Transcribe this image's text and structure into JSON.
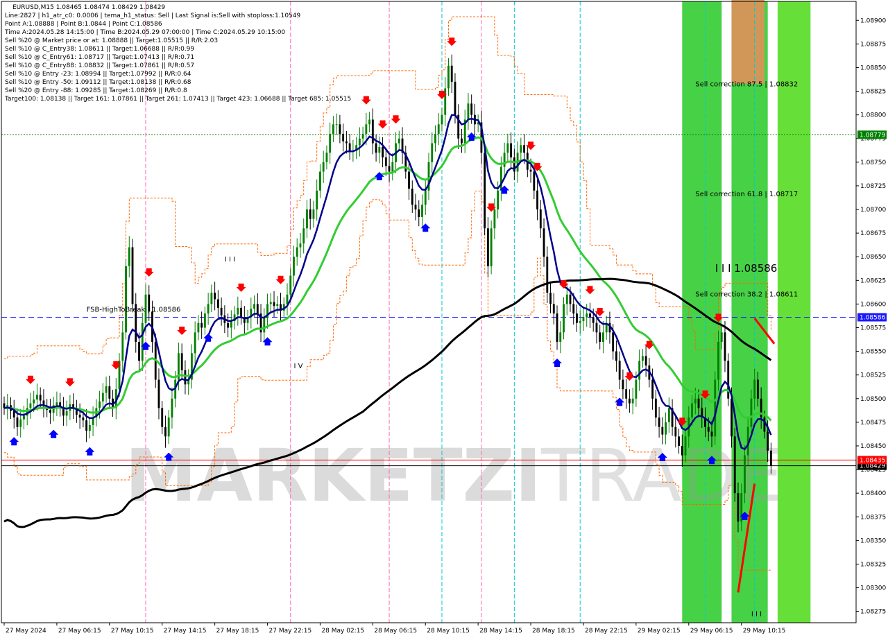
{
  "chart_data": {
    "type": "candlestick",
    "symbol": "EURUSD",
    "timeframe": "M15",
    "header": "EURUSD,M15  1.08465 1.08474 1.08429 1.08429",
    "info_lines": [
      "Line:2827 | h1_atr_c0: 0.0006 | tema_h1_status: Sell | Last Signal is:Sell with stoploss:1.10549",
      "Point A:1.08888 | Point B:1.0844 | Point C:1.08586",
      "Time A:2024.05.28 14:15:00 | Time B:2024.05.29 07:00:00 | Time C:2024.05.29 10:15:00",
      "Sell %20 @ Market price or at: 1.08888 || Target:1.05515 || R/R:2.03",
      "Sell %10 @ C_Entry38: 1.08611 || Target:1.06688 || R/R:0.99",
      "Sell %10 @ C_Entry61: 1.08717 || Target:1.07413 || R/R:0.71",
      "Sell %10 @ C_Entry88: 1.08832 || Target:1.07861 || R/R:0.57",
      "Sell %10 @ Entry -23: 1.08994 || Target:1.07992 || R/R:0.64",
      "Sell %10 @ Entry -50: 1.09112 || Target:1.08138 || R/R:0.68",
      "Sell %20 @ Entry -88: 1.09285 || Target:1.08269 || R/R:0.8",
      "Target100: 1.08138 || Target 161: 1.07861 || Target 261: 1.07413 || Target 423: 1.06688 || Target 685: 1.05515"
    ],
    "y_range": [
      1.0827,
      1.0893
    ],
    "y_ticks": [
      1.0898,
      1.0895,
      1.0885,
      1.0885,
      1.088,
      1.0878,
      1.0875,
      1.0873,
      1.087,
      1.0868,
      1.0865,
      1.0863,
      1.086,
      1.0858,
      1.0855,
      1.0853,
      1.085,
      1.0848,
      1.0845,
      1.0843,
      1.084,
      1.0838,
      1.0835,
      1.0833,
      1.083,
      1.0828
    ],
    "y_tick_labels": [
      "1.08900",
      "1.08875",
      "1.08850",
      "1.08825",
      "1.08800",
      "1.08775",
      "1.08750",
      "1.08725",
      "1.08700",
      "1.08675",
      "1.08650",
      "1.08625",
      "1.08600",
      "1.08575",
      "1.08550",
      "1.08525",
      "1.08500",
      "1.08475",
      "1.08450",
      "1.08425",
      "1.08400",
      "1.08375",
      "1.08350",
      "1.08325",
      "1.08300",
      "1.08275"
    ],
    "y_tick_values": [
      1.089,
      1.08875,
      1.0885,
      1.08825,
      1.088,
      1.08775,
      1.0875,
      1.08725,
      1.087,
      1.08675,
      1.0865,
      1.08625,
      1.086,
      1.08575,
      1.0855,
      1.08525,
      1.085,
      1.08475,
      1.0845,
      1.08425,
      1.084,
      1.08375,
      1.0835,
      1.08325,
      1.083,
      1.08275
    ],
    "x_labels": [
      "27 May 2024",
      "27 May 06:15",
      "27 May 10:15",
      "27 May 14:15",
      "27 May 18:15",
      "27 May 22:15",
      "28 May 02:15",
      "28 May 06:15",
      "28 May 10:15",
      "28 May 14:15",
      "28 May 18:15",
      "28 May 22:15",
      "29 May 02:15",
      "29 May 06:15",
      "29 May 10:15"
    ],
    "x_label_index": [
      0,
      16,
      32,
      48,
      64,
      80,
      96,
      112,
      128,
      144,
      160,
      176,
      192,
      208,
      224
    ],
    "bar_count": 240,
    "candles": [],
    "close_series": [
      1.0849,
      1.08493,
      1.08487,
      1.0848,
      1.0847,
      1.08478,
      1.08482,
      1.0849,
      1.08495,
      1.08499,
      1.08504,
      1.08498,
      1.08492,
      1.08488,
      1.08485,
      1.08493,
      1.08496,
      1.08491,
      1.08482,
      1.08487,
      1.08494,
      1.0849,
      1.08483,
      1.0848,
      1.08477,
      1.08466,
      1.08472,
      1.0848,
      1.0849,
      1.08497,
      1.08506,
      1.08513,
      1.085,
      1.0849,
      1.0851,
      1.0854,
      1.0857,
      1.0864,
      1.0866,
      1.086,
      1.0856,
      1.0854,
      1.0858,
      1.0861,
      1.08592,
      1.0856,
      1.0852,
      1.0849,
      1.0847,
      1.0846,
      1.0848,
      1.085,
      1.0852,
      1.08548,
      1.0853,
      1.08515,
      1.0852,
      1.08548,
      1.0857,
      1.0858,
      1.08575,
      1.0859,
      1.086,
      1.08612,
      1.08605,
      1.08596,
      1.08588,
      1.0858,
      1.08575,
      1.08582,
      1.08589,
      1.08596,
      1.08586,
      1.0858,
      1.08586,
      1.08595,
      1.086,
      1.0859,
      1.0857,
      1.08585,
      1.086,
      1.08602,
      1.08598,
      1.086,
      1.08593,
      1.086,
      1.0861,
      1.0863,
      1.0865,
      1.0866,
      1.08664,
      1.0868,
      1.087,
      1.0869,
      1.087,
      1.0872,
      1.0874,
      1.0875,
      1.0876,
      1.0878,
      1.0879,
      1.0879,
      1.0878,
      1.08772,
      1.0877,
      1.08762,
      1.08762,
      1.08768,
      1.08775,
      1.0878,
      1.0879,
      1.08795,
      1.0877,
      1.0876,
      1.08766,
      1.08755,
      1.08746,
      1.0874,
      1.0875,
      1.0877,
      1.08775,
      1.0876,
      1.0874,
      1.08722,
      1.08705,
      1.087,
      1.08692,
      1.08705,
      1.0872,
      1.0875,
      1.0877,
      1.0878,
      1.0879,
      1.088,
      1.08828,
      1.08852,
      1.08835,
      1.088,
      1.08775,
      1.0877,
      1.08795,
      1.08812,
      1.088,
      1.0879,
      1.08792,
      1.0876,
      1.0868,
      1.0864,
      1.0868,
      1.087,
      1.0872,
      1.08745,
      1.0876,
      1.0877,
      1.08755,
      1.0874,
      1.0876,
      1.08768,
      1.0876,
      1.08742,
      1.0874,
      1.0872,
      1.087,
      1.0868,
      1.0865,
      1.08612,
      1.086,
      1.0859,
      1.0856,
      1.0857,
      1.086,
      1.0861,
      1.086,
      1.0859,
      1.0858,
      1.08582,
      1.08586,
      1.0859,
      1.08586,
      1.0858,
      1.0857,
      1.0856,
      1.0857,
      1.0858,
      1.0857,
      1.0855,
      1.0854,
      1.0852,
      1.0851,
      1.085,
      1.08495,
      1.085,
      1.0852,
      1.0854,
      1.08545,
      1.08535,
      1.0852,
      1.085,
      1.0848,
      1.0847,
      1.08462,
      1.08475,
      1.0849,
      1.0847,
      1.0846,
      1.0845,
      1.0844,
      1.0846,
      1.0848,
      1.08495,
      1.085,
      1.0849,
      1.0848,
      1.0847,
      1.08465,
      1.0846,
      1.0852,
      1.0856,
      1.0857,
      1.0854,
      1.085,
      1.0846,
      1.084,
      1.0837,
      1.084,
      1.0844,
      1.0847,
      1.085,
      1.0852,
      1.085,
      1.0848,
      1.08465,
      1.08445,
      1.08429
    ],
    "horizontal_levels": [
      {
        "name": "current-price",
        "value": 1.08429,
        "label": "1.08429",
        "color": "#000000"
      },
      {
        "name": "red-level",
        "value": 1.08435,
        "label": "1.08435",
        "color": "#ff0000"
      },
      {
        "name": "fsb-high-to-break",
        "value": 1.08586,
        "label": "1.08586",
        "color": "#1a1aff"
      },
      {
        "name": "green-level",
        "value": 1.08779,
        "label": "1.08779",
        "color": "#008000"
      }
    ],
    "annotations": [
      {
        "text": "FSB-HighToBreak | 1.08586",
        "bar": 25,
        "value": 1.08592
      },
      {
        "text": "Sell correction 87.5 | 1.08832",
        "bar": 210,
        "value": 1.0883
      },
      {
        "text": "Sell correction 61.8 | 1.08717",
        "bar": 210,
        "value": 1.08714
      },
      {
        "text": "Sell correction 38.2 | 1.08611",
        "bar": 210,
        "value": 1.08608
      },
      {
        "text": "I I I 1.08586",
        "bar": 216,
        "value": 1.08634
      },
      {
        "text": "I I I",
        "bar": 67,
        "value": 1.08645
      },
      {
        "text": "I V",
        "bar": 88,
        "value": 1.08532
      },
      {
        "text": "I I I",
        "bar": 227,
        "value": 1.0827
      }
    ],
    "zones": [
      {
        "name": "green-zone-1",
        "start_bar": 206,
        "end_bar": 218,
        "color": "#33cc33"
      },
      {
        "name": "green-zone-2",
        "start_bar": 221,
        "end_bar": 232,
        "color": "#33cc33"
      },
      {
        "name": "orange-zone",
        "start_bar": 221,
        "end_bar": 231,
        "top": 1.0899,
        "bottom": 1.08833,
        "color": "#d9935a"
      },
      {
        "name": "green-zone-3",
        "start_bar": 235,
        "end_bar": 245,
        "color": "#55dd22"
      }
    ],
    "colors": {
      "bull_body": "#008000",
      "bear_body": "#000000",
      "ma_fast": "#00008b",
      "ma_mid": "#33cc33",
      "ma_slow": "#000000",
      "band": "#ff6600",
      "arrow_sell": "#ff0000",
      "arrow_buy": "#0000ff",
      "trend_line": "#ff0000",
      "vline_pink": "#ff69b4",
      "vline_cyan": "#00cccc"
    },
    "vertical_lines": [
      {
        "bar": 43,
        "color": "pink"
      },
      {
        "bar": 87,
        "color": "pink"
      },
      {
        "bar": 117,
        "color": "pink"
      },
      {
        "bar": 145,
        "color": "pink"
      },
      {
        "bar": 133,
        "color": "cyan"
      },
      {
        "bar": 155,
        "color": "cyan"
      },
      {
        "bar": 175,
        "color": "cyan"
      },
      {
        "bar": 213,
        "color": "cyan"
      },
      {
        "bar": 228,
        "color": "cyan"
      }
    ],
    "watermark": "MARKETZITRADE",
    "grid": false
  }
}
